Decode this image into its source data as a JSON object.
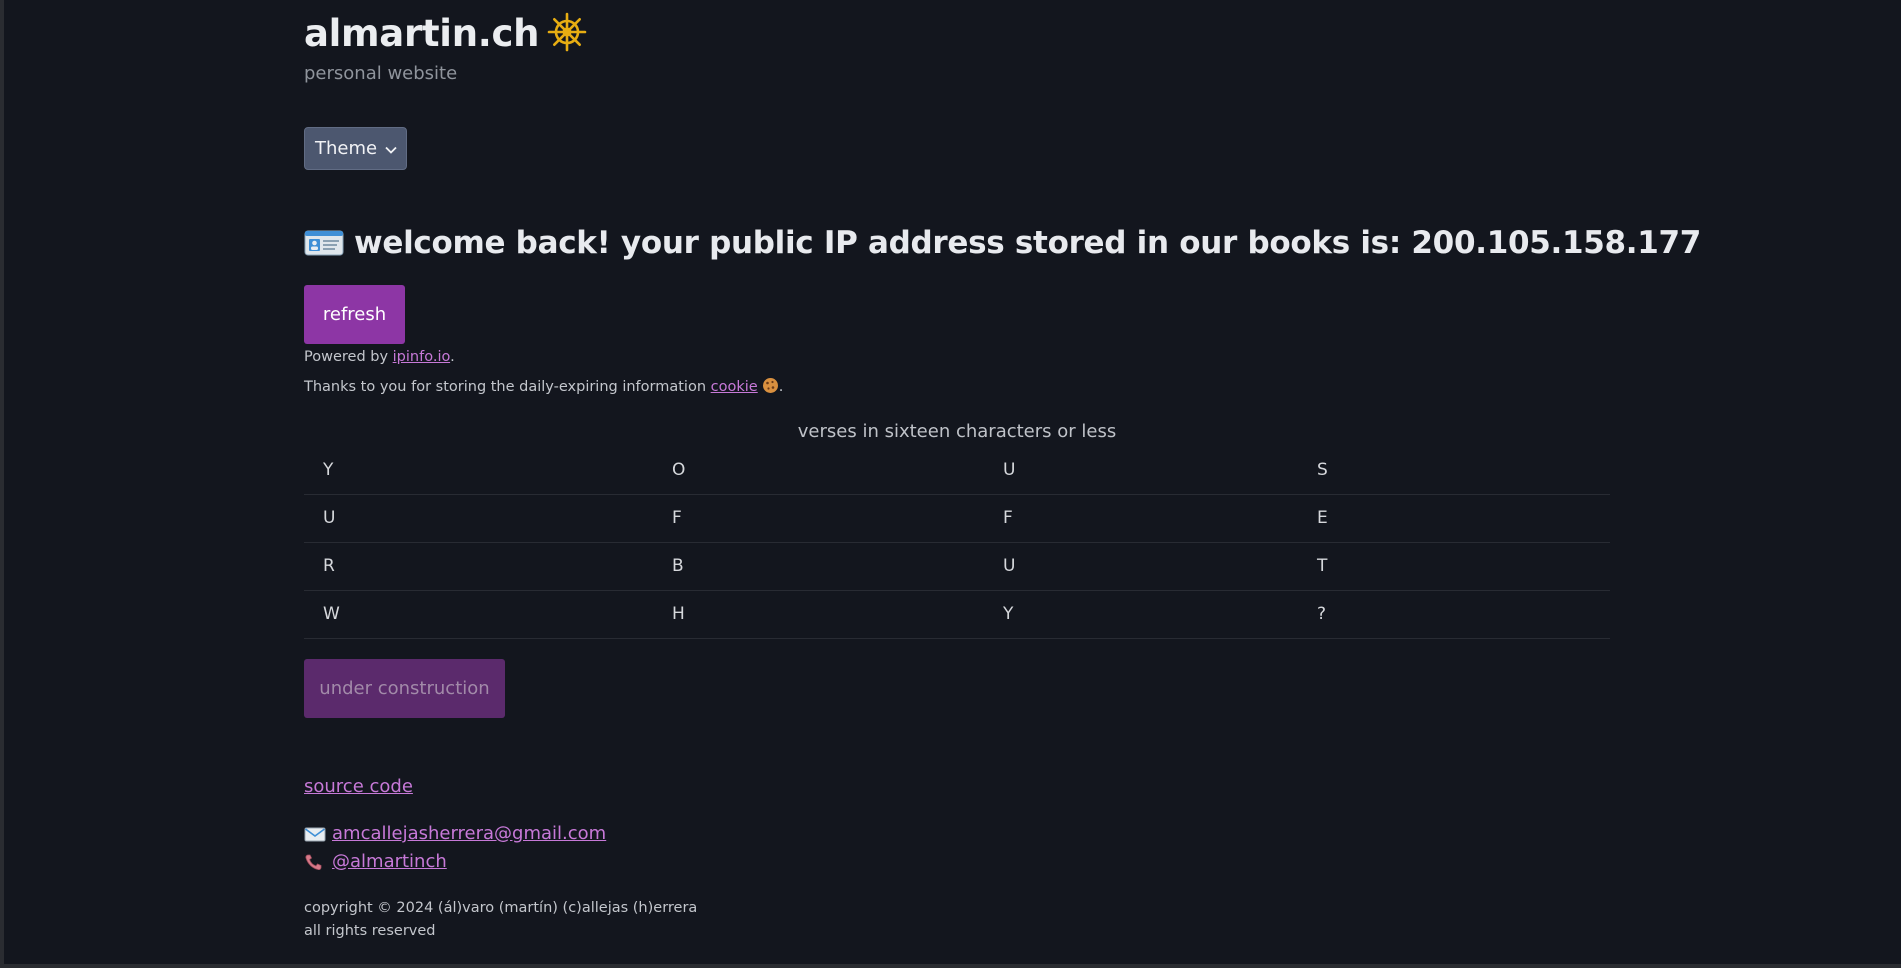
{
  "header": {
    "site_title": "almartin.ch",
    "subtitle": "personal website",
    "theme_button_label": "Theme"
  },
  "ip_section": {
    "headline": "welcome back! your public IP address stored in our books is: 200.105.158.177",
    "refresh_label": "refresh",
    "powered_prefix": "Powered by ",
    "powered_link": "ipinfo.io",
    "powered_suffix": ".",
    "thanks_prefix": "Thanks to you for storing the daily-expiring information ",
    "cookie_link": "cookie",
    "thanks_suffix": "."
  },
  "verses": {
    "caption": "verses in sixteen characters or less",
    "rows": [
      [
        "Y",
        "O",
        "U",
        "S"
      ],
      [
        "U",
        "F",
        "F",
        "E"
      ],
      [
        "R",
        "B",
        "U",
        "T"
      ],
      [
        "W",
        "H",
        "Y",
        "?"
      ]
    ]
  },
  "construction_label": "under construction",
  "footer": {
    "source_code_label": "source code",
    "email": "amcallejasherrera@gmail.com",
    "handle": "@almartinch",
    "copyright": "copyright © 2024 (ál)varo (martín) (c)allejas (h)errera",
    "rights": "all rights reserved"
  },
  "icons": {
    "title": "ship-wheel-icon",
    "headline": "id-card-icon",
    "theme": "chevron-down-icon",
    "cookie": "cookie-icon",
    "email": "email-icon",
    "phone": "phone-icon"
  },
  "colors": {
    "background": "#13161e",
    "accent": "#8d36a5",
    "link": "#c779d8",
    "theme_button": "#4c576f"
  }
}
